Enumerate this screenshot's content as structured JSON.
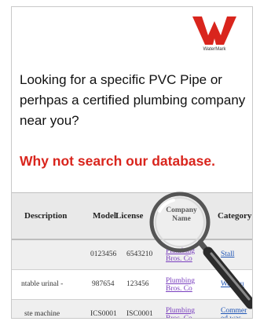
{
  "logo": {
    "caption": "WaterMark",
    "color": "#d9251d"
  },
  "headline": "Looking for a specific PVC Pipe or perhpas a certified plumbing company near you?",
  "cta": "Why not search our database.",
  "table": {
    "headers": {
      "description": "Description",
      "model": "Model",
      "license": "License",
      "company": "Company Name",
      "category": "Category"
    },
    "rows": [
      {
        "description": "",
        "model": "0123456",
        "license": "6543210",
        "company": "Plumbing Bros. Co",
        "category": "Stall"
      },
      {
        "description": "ntable urinal -",
        "model": "987654",
        "license": "123456",
        "company": "Plumbing Bros. Co",
        "category": "Wall hu"
      },
      {
        "description": "ste machine",
        "model": "ICS0001",
        "license": "ISC0001",
        "company": "Plumbing Bros. Co",
        "category": "Commer ed was"
      }
    ]
  },
  "colors": {
    "accent": "#d9251d",
    "link": "#7a3fbf"
  }
}
